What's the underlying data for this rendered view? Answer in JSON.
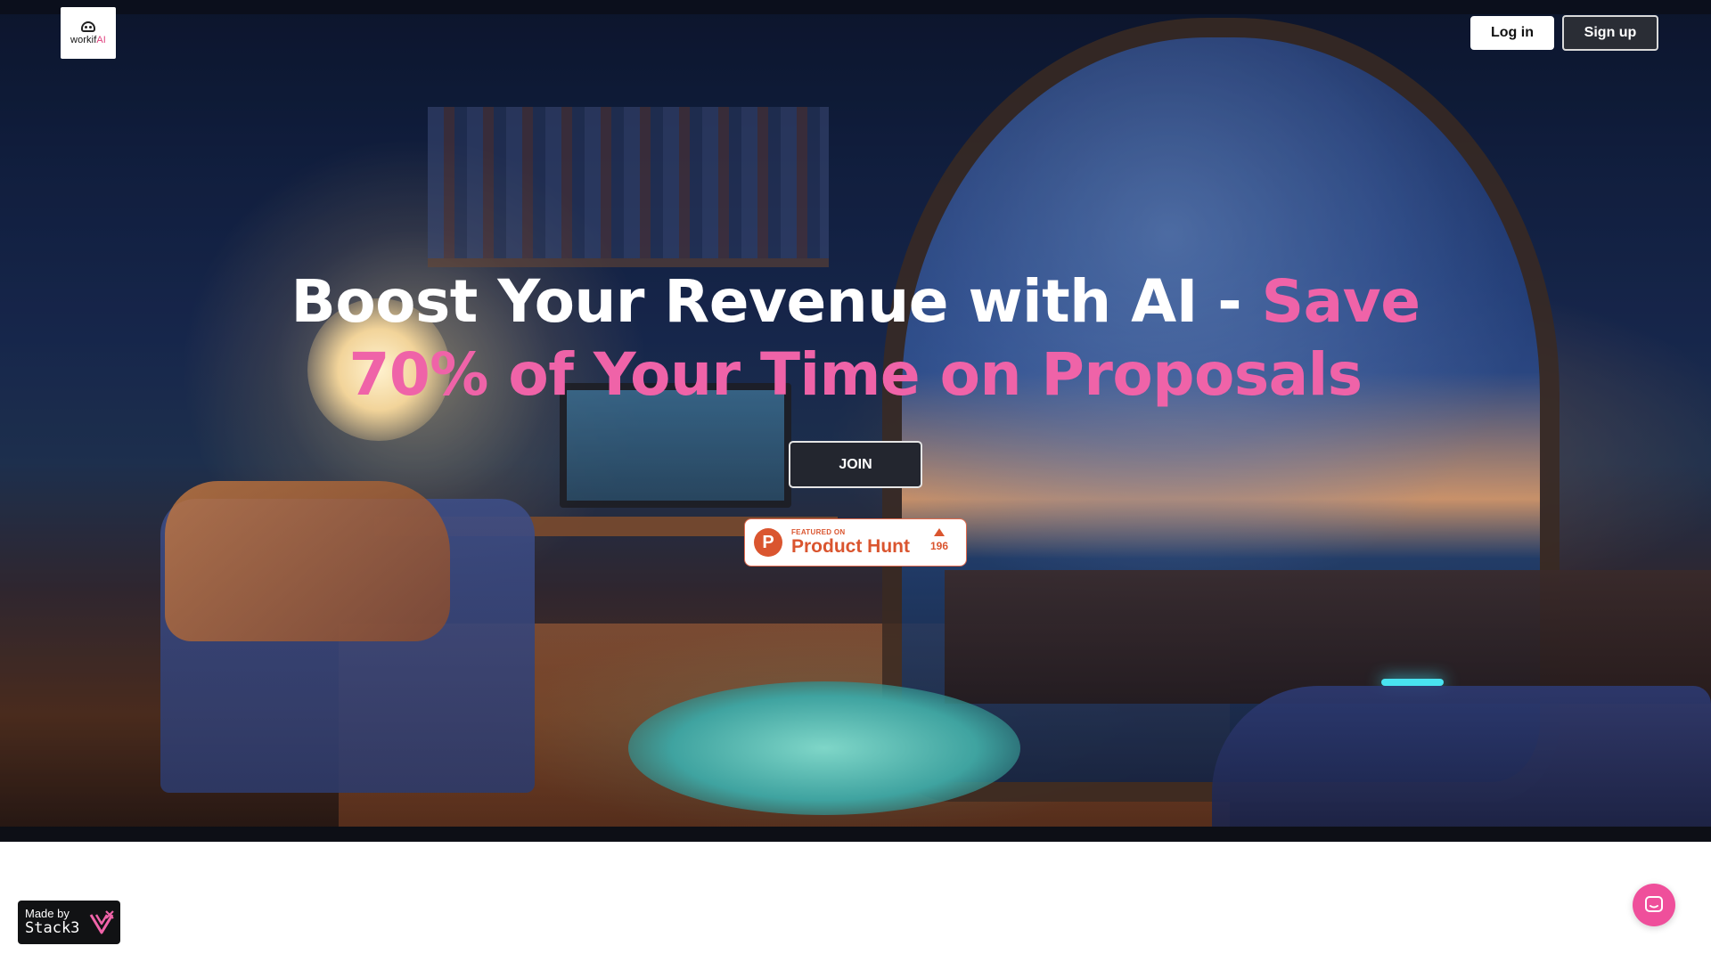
{
  "brand": {
    "logo_text": "workif",
    "logo_text_accent": "AI",
    "logo_icon": "robot-face-icon"
  },
  "nav": {
    "login_label": "Log in",
    "signup_label": "Sign up"
  },
  "hero": {
    "headline_part1": "Boost Your Revenue with AI - ",
    "headline_highlight_line1": "Save",
    "headline_highlight_line2": "70% of Your Time on Proposals",
    "join_label": "JOIN",
    "highlight_color": "#ef63a8"
  },
  "product_hunt": {
    "featured_label": "FEATURED ON",
    "name": "Product Hunt",
    "logo_letter": "P",
    "upvote_icon": "triangle-up-icon",
    "votes": "196",
    "color": "#da552f"
  },
  "footer_badge": {
    "made_by": "Made by",
    "name": "Stack3",
    "icon": "stack3-logo-icon"
  },
  "chat": {
    "icon": "chat-bubble-icon",
    "color": "#ef4f9b"
  }
}
